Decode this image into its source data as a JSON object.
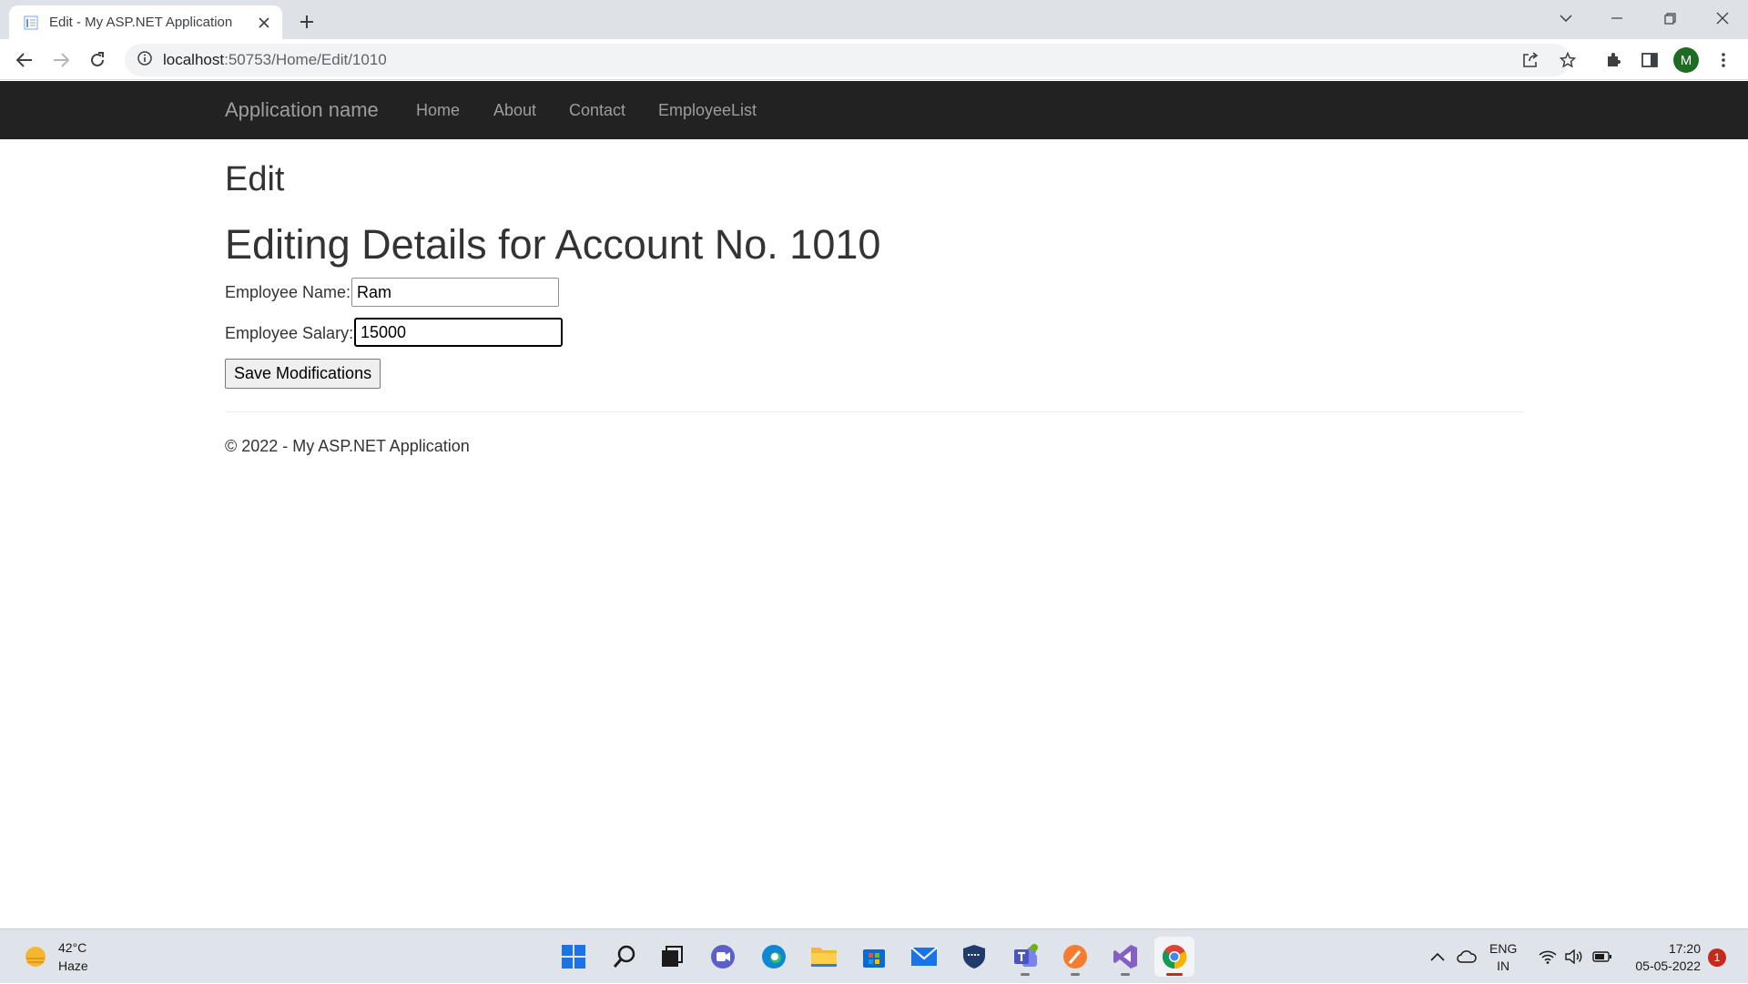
{
  "browser": {
    "tab_title": "Edit - My ASP.NET Application",
    "url_host": "localhost",
    "url_rest": ":50753/Home/Edit/1010",
    "profile_initial": "M"
  },
  "site": {
    "brand": "Application name",
    "nav": [
      "Home",
      "About",
      "Contact",
      "EmployeeList"
    ]
  },
  "page": {
    "heading": "Edit",
    "subheading": "Editing Details for Account No. 1010",
    "name_label": "Employee Name:",
    "name_value": "Ram",
    "salary_label": "Employee Salary:",
    "salary_value": "15000",
    "save_label": "Save Modifications",
    "footer": "© 2022 - My ASP.NET Application"
  },
  "taskbar": {
    "weather_temp": "42°C",
    "weather_desc": "Haze",
    "lang_1": "ENG",
    "lang_2": "IN",
    "time": "17:20",
    "date": "05-05-2022",
    "notifications": "1",
    "apps": [
      "start",
      "search",
      "task-view",
      "chat",
      "edge",
      "file-explorer",
      "store",
      "mail",
      "security",
      "teams",
      "paint",
      "visual-studio",
      "chrome"
    ]
  }
}
